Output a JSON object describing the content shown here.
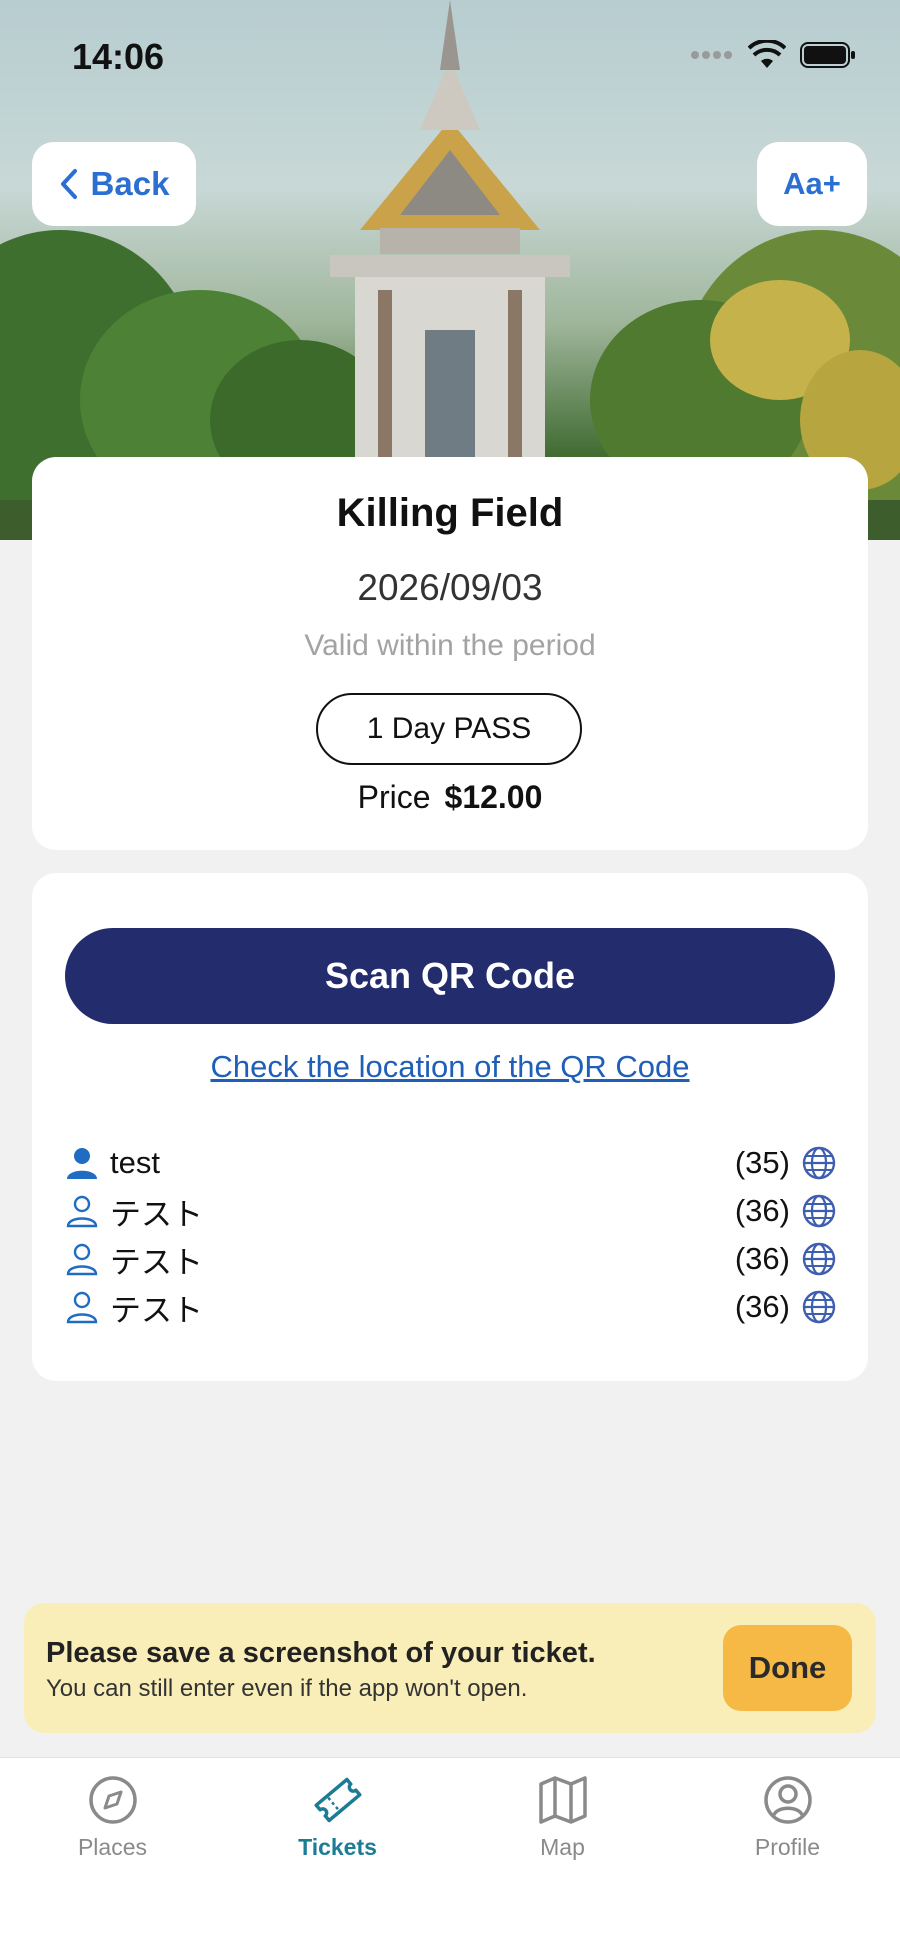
{
  "status_bar": {
    "time": "14:06"
  },
  "header": {
    "back_label": "Back",
    "text_size_label": "Aa+"
  },
  "ticket": {
    "place_name": "Killing Field",
    "date": "2026/09/03",
    "validity_note": "Valid within the period",
    "pass_type": "1 Day PASS",
    "price_label": "Price",
    "price_value": "$12.00"
  },
  "scan": {
    "button_label": "Scan QR Code",
    "location_link": "Check the location of the QR Code"
  },
  "people": [
    {
      "name": "test",
      "age": "(35)",
      "icon": "person-filled-icon"
    },
    {
      "name": "テスト",
      "age": "(36)",
      "icon": "person-outline-icon"
    },
    {
      "name": "テスト",
      "age": "(36)",
      "icon": "person-outline-icon"
    },
    {
      "name": "テスト",
      "age": "(36)",
      "icon": "person-outline-icon"
    }
  ],
  "banner": {
    "title": "Please save a screenshot of your ticket.",
    "subtitle": "You can still enter even if the app won't open.",
    "done_label": "Done"
  },
  "tabs": [
    {
      "label": "Places",
      "icon": "compass-icon",
      "active": false
    },
    {
      "label": "Tickets",
      "icon": "ticket-icon",
      "active": true
    },
    {
      "label": "Map",
      "icon": "map-icon",
      "active": false
    },
    {
      "label": "Profile",
      "icon": "profile-icon",
      "active": false
    }
  ],
  "colors": {
    "accent_blue": "#2a6fd1",
    "scan_button": "#232c6c",
    "banner_bg": "#f9eeb8",
    "done_button": "#f6b946",
    "active_tab": "#1d7c95"
  }
}
